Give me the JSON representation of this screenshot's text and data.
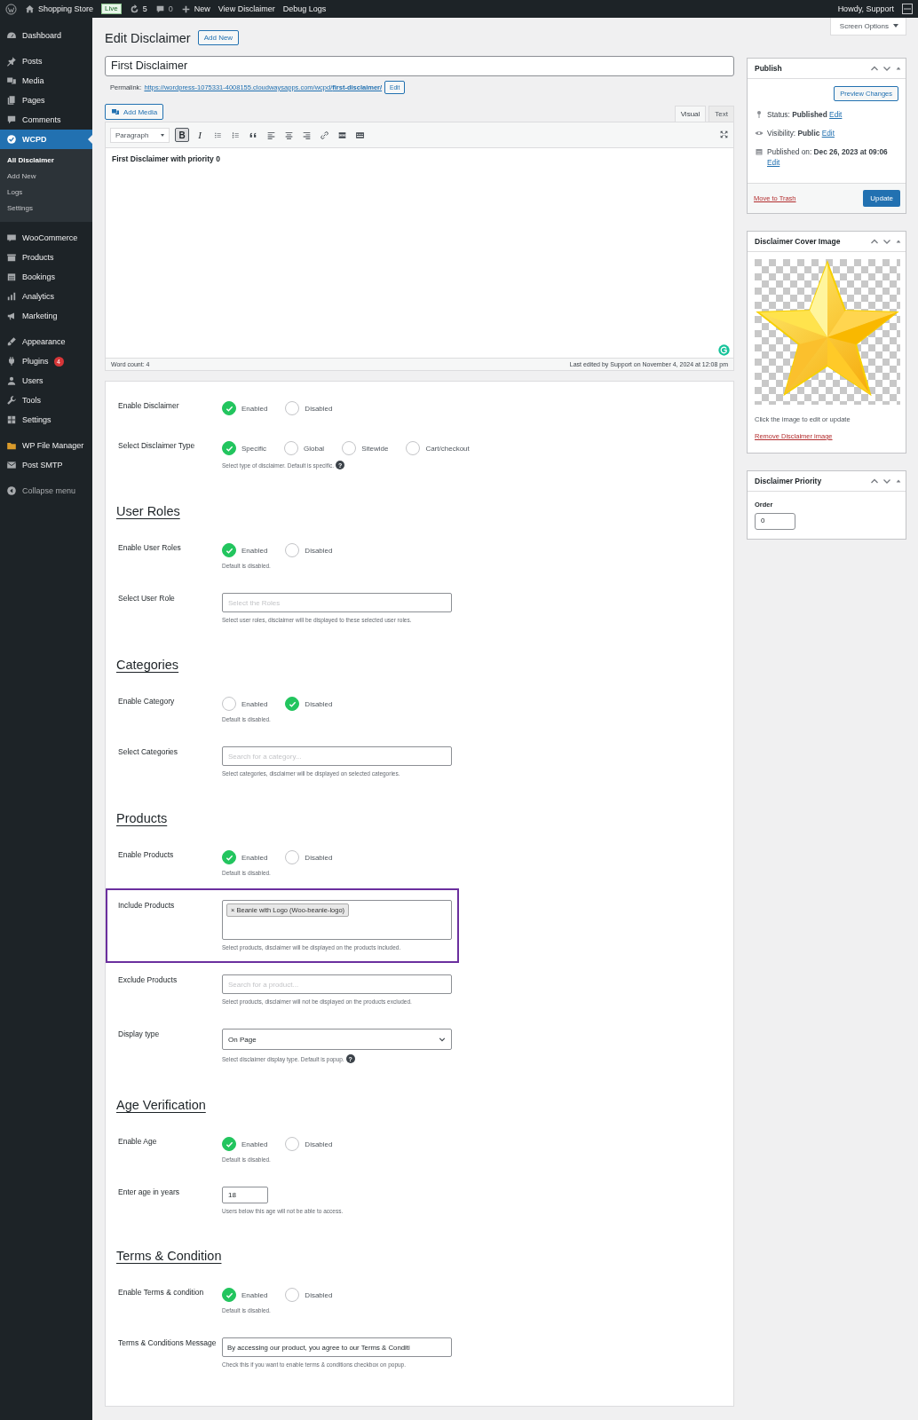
{
  "admin_bar": {
    "items": [
      {
        "kind": "logo"
      },
      {
        "kind": "home",
        "label": "Shopping Store"
      },
      {
        "kind": "badge",
        "label": "Live"
      },
      {
        "kind": "updates",
        "label": "5"
      },
      {
        "kind": "comments",
        "label": "0"
      },
      {
        "kind": "new",
        "label": "New"
      },
      {
        "kind": "link",
        "label": "View Disclaimer"
      },
      {
        "kind": "link",
        "label": "Debug Logs"
      }
    ],
    "account": "Howdy, Support"
  },
  "sidebar": {
    "groups": [
      [
        {
          "label": "Dashboard",
          "selected": false
        }
      ],
      [
        {
          "label": "Posts",
          "selected": false
        },
        {
          "label": "Media",
          "selected": false
        },
        {
          "label": "Pages",
          "selected": false
        },
        {
          "label": "Comments",
          "selected": false
        },
        {
          "label": "WCPD",
          "selected": true,
          "children": [
            {
              "label": "All Disclaimer",
              "selected": true
            },
            {
              "label": "Add New",
              "selected": false
            },
            {
              "label": "Logs",
              "selected": false
            },
            {
              "label": "Settings",
              "selected": false
            }
          ]
        }
      ],
      [
        {
          "label": "WooCommerce",
          "selected": false
        },
        {
          "label": "Products",
          "selected": false
        },
        {
          "label": "Bookings",
          "selected": false
        },
        {
          "label": "Analytics",
          "selected": false
        },
        {
          "label": "Marketing",
          "selected": false
        }
      ],
      [
        {
          "label": "Appearance",
          "selected": false
        },
        {
          "label": "Plugins",
          "selected": false,
          "badge": "4"
        },
        {
          "label": "Users",
          "selected": false
        },
        {
          "label": "Tools",
          "selected": false
        },
        {
          "label": "Settings",
          "selected": false
        }
      ],
      [
        {
          "label": "WP File Manager",
          "selected": false
        },
        {
          "label": "Post SMTP",
          "selected": false
        }
      ]
    ],
    "collapse": "Collapse menu"
  },
  "header": {
    "title": "Edit Disclaimer",
    "add_new": "Add New",
    "screen_options": "Screen Options"
  },
  "editor": {
    "title_value": "First Disclaimer",
    "permalink_label": "Permalink:",
    "permalink": "https://wordpress-1075331-4008155.cloudwaysapps.com/wcpd/**first-disclaimer/**",
    "permalink_edit": "Edit",
    "add_media": "Add Media",
    "tabs": [
      {
        "label": "Visual",
        "selected": true
      },
      {
        "label": "Text",
        "selected": false
      }
    ],
    "format": "Paragraph",
    "toolbar": [
      {
        "kind": "bold",
        "label": "B",
        "active": true
      },
      {
        "kind": "italic",
        "label": "I",
        "active": false
      },
      {
        "kind": "ul",
        "active": false
      },
      {
        "kind": "ol",
        "active": false
      },
      {
        "kind": "quote",
        "active": false
      },
      {
        "kind": "alignleft",
        "active": false
      },
      {
        "kind": "aligncenter",
        "active": false
      },
      {
        "kind": "alignright",
        "active": false
      },
      {
        "kind": "link",
        "active": false
      },
      {
        "kind": "more",
        "active": false
      },
      {
        "kind": "kitchen",
        "active": false
      }
    ],
    "content": "First Disclaimer with priority 0",
    "word_count": "Word count: 4",
    "last_edited": "Last edited by Support on November 4, 2024 at 12:08 pm"
  },
  "form": {
    "sections": [
      {
        "fields": [
          {
            "kind": "radio",
            "label": "Enable Disclaimer",
            "options": [
              {
                "label": "Enabled",
                "selected": true
              },
              {
                "label": "Disabled",
                "selected": false
              }
            ]
          },
          {
            "kind": "radio",
            "label": "Select Disclaimer Type",
            "options": [
              {
                "label": "Specific",
                "selected": true
              },
              {
                "label": "Global",
                "selected": false
              },
              {
                "label": "Sitewide",
                "selected": false
              },
              {
                "label": "Cart/checkout",
                "selected": false
              }
            ],
            "help": "Select type of disclaimer. Default is specific.",
            "help_badge": "?"
          }
        ]
      },
      {
        "heading": "User Roles",
        "fields": [
          {
            "kind": "radio",
            "label": "Enable User Roles",
            "options": [
              {
                "label": "Enabled",
                "selected": true
              },
              {
                "label": "Disabled",
                "selected": false
              }
            ],
            "help": "Default is disabled."
          },
          {
            "kind": "search",
            "label": "Select User Role",
            "placeholder": "Select the Roles",
            "help": "Select user roles, disclaimer will be displayed to these selected user roles."
          }
        ]
      },
      {
        "heading": "Categories",
        "fields": [
          {
            "kind": "radio",
            "label": "Enable Category",
            "options": [
              {
                "label": "Enabled",
                "selected": false
              },
              {
                "label": "Disabled",
                "selected": true
              }
            ],
            "help": "Default is disabled."
          },
          {
            "kind": "search",
            "label": "Select Categories",
            "placeholder": "Search for a category...",
            "help": "Select categories, disclaimer will be displayed on selected categories."
          }
        ]
      },
      {
        "heading": "Products",
        "fields": [
          {
            "kind": "radio",
            "label": "Enable Products",
            "options": [
              {
                "label": "Enabled",
                "selected": true
              },
              {
                "label": "Disabled",
                "selected": false
              }
            ],
            "help": "Default is disabled."
          },
          {
            "kind": "tags",
            "label": "Include Products",
            "highlighted": true,
            "tags": [
              {
                "label": "Beanie with Logo (Woo-beanie-logo)",
                "remove": "×"
              }
            ],
            "help": "Select products, disclaimer will be displayed on the products included."
          },
          {
            "kind": "search",
            "label": "Exclude Products",
            "placeholder": "Search for a product...",
            "help": "Select products, disclaimer will not be displayed on the products excluded."
          },
          {
            "kind": "dropdown",
            "label": "Display type",
            "value": "On Page",
            "help": "Select disclaimer display type. Default is popup.",
            "help_badge": "?"
          }
        ]
      },
      {
        "heading": "Age Verification",
        "fields": [
          {
            "kind": "radio",
            "label": "Enable Age",
            "options": [
              {
                "label": "Enabled",
                "selected": true
              },
              {
                "label": "Disabled",
                "selected": false
              }
            ],
            "help": "Default is disabled."
          },
          {
            "kind": "number",
            "label": "Enter age in years",
            "value": "18",
            "help": "Users below this age will not be able to access."
          }
        ]
      },
      {
        "heading": "Terms & Condition",
        "fields": [
          {
            "kind": "radio",
            "label": "Enable Terms & condition",
            "options": [
              {
                "label": "Enabled",
                "selected": true
              },
              {
                "label": "Disabled",
                "selected": false
              }
            ],
            "help": "Default is disabled."
          },
          {
            "kind": "text",
            "label": "Terms & Conditions Message",
            "value": "By accessing our product, you agree to our Terms & Conditi",
            "help": "Check this if you want to enable terms & conditions checkbox on popup."
          }
        ]
      }
    ]
  },
  "publish": {
    "title": "Publish",
    "preview": "Preview Changes",
    "lines": [
      {
        "text": "Status: **Published**",
        "link": "Edit"
      },
      {
        "text": "Visibility: **Public**",
        "link": "Edit"
      },
      {
        "text": "Published on: **Dec 26, 2023 at 09:06**",
        "link": "Edit"
      }
    ],
    "trash": "Move to Trash",
    "update": "Update"
  },
  "cover": {
    "title": "Disclaimer Cover Image",
    "hint": "Click the image to edit or update",
    "remove": "Remove Disclaimer image"
  },
  "priority": {
    "title": "Disclaimer Priority",
    "label": "Order",
    "value": "0"
  }
}
